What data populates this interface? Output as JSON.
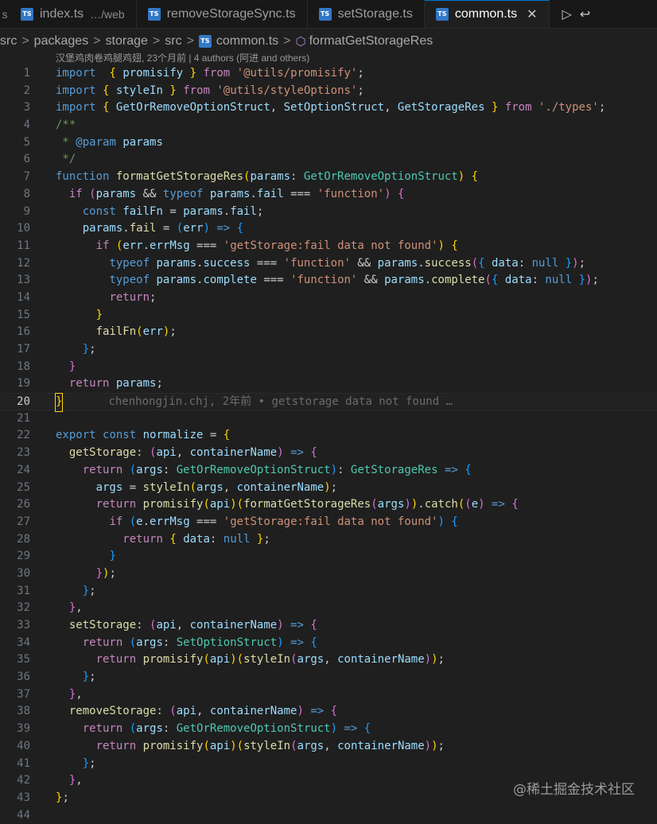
{
  "tabs": [
    {
      "label": "index.ts",
      "desc": "…/web",
      "active": false
    },
    {
      "label": "removeStorageSync.ts",
      "desc": "",
      "active": false
    },
    {
      "label": "setStorage.ts",
      "desc": "",
      "active": false
    },
    {
      "label": "common.ts",
      "desc": "",
      "active": true
    }
  ],
  "tab_icon_text": "TS",
  "tab_close_glyph": "✕",
  "tab_actions": [
    "▷",
    "↩"
  ],
  "breadcrumb": {
    "items": [
      "src",
      "packages",
      "storage",
      "src",
      "common.ts",
      "formatGetStorageRes"
    ],
    "separator": ">"
  },
  "blame_top": "汉堡鸡肉卷鸡腿鸡翅, 23个月前 | 4 authors (阿进 and others)",
  "inline_blame": "chenhongjin.chj, 2年前 • getstorage data not found …",
  "current_line": 20,
  "watermark": "@稀土掘金技术社区",
  "line_numbers": [
    "1",
    "2",
    "3",
    "4",
    "5",
    "6",
    "7",
    "8",
    "9",
    "10",
    "11",
    "12",
    "13",
    "14",
    "15",
    "16",
    "17",
    "18",
    "19",
    "20",
    "21",
    "22",
    "23",
    "24",
    "25",
    "26",
    "27",
    "28",
    "29",
    "30",
    "31",
    "32",
    "33",
    "34",
    "35",
    "36",
    "37",
    "38",
    "39",
    "40",
    "41",
    "42",
    "43",
    "44"
  ],
  "code": [
    [
      [
        "k",
        "import"
      ],
      [
        "",
        "  "
      ],
      [
        "b1",
        "{"
      ],
      [
        "",
        " "
      ],
      [
        "v",
        "promisify"
      ],
      [
        "",
        " "
      ],
      [
        "b1",
        "}"
      ],
      [
        "",
        " "
      ],
      [
        "c",
        "from"
      ],
      [
        "",
        " "
      ],
      [
        "s",
        "'@utils/promisify'"
      ],
      [
        "",
        ";"
      ]
    ],
    [
      [
        "k",
        "import"
      ],
      [
        "",
        " "
      ],
      [
        "b1",
        "{"
      ],
      [
        "",
        " "
      ],
      [
        "v",
        "styleIn"
      ],
      [
        "",
        " "
      ],
      [
        "b1",
        "}"
      ],
      [
        "",
        " "
      ],
      [
        "c",
        "from"
      ],
      [
        "",
        " "
      ],
      [
        "s",
        "'@utils/styleOptions'"
      ],
      [
        "",
        ";"
      ]
    ],
    [
      [
        "k",
        "import"
      ],
      [
        "",
        " "
      ],
      [
        "b1",
        "{"
      ],
      [
        "",
        " "
      ],
      [
        "v",
        "GetOrRemoveOptionStruct"
      ],
      [
        "",
        ", "
      ],
      [
        "v",
        "SetOptionStruct"
      ],
      [
        "",
        ", "
      ],
      [
        "v",
        "GetStorageRes"
      ],
      [
        "",
        " "
      ],
      [
        "b1",
        "}"
      ],
      [
        "",
        " "
      ],
      [
        "c",
        "from"
      ],
      [
        "",
        " "
      ],
      [
        "s",
        "'./types'"
      ],
      [
        "",
        ";"
      ]
    ],
    [
      [
        "cm",
        "/**"
      ]
    ],
    [
      [
        "cm",
        " * "
      ],
      [
        "cmt",
        "@param"
      ],
      [
        "",
        " "
      ],
      [
        "v",
        "params"
      ]
    ],
    [
      [
        "cm",
        " */"
      ]
    ],
    [
      [
        "k",
        "function"
      ],
      [
        "",
        " "
      ],
      [
        "f",
        "formatGetStorageRes"
      ],
      [
        "b1",
        "("
      ],
      [
        "v",
        "params"
      ],
      [
        "",
        ": "
      ],
      [
        "t",
        "GetOrRemoveOptionStruct"
      ],
      [
        "b1",
        ")"
      ],
      [
        "",
        " "
      ],
      [
        "b1",
        "{"
      ]
    ],
    [
      [
        "",
        "  "
      ],
      [
        "c",
        "if"
      ],
      [
        "",
        " "
      ],
      [
        "b2",
        "("
      ],
      [
        "v",
        "params"
      ],
      [
        "",
        " && "
      ],
      [
        "k",
        "typeof"
      ],
      [
        "",
        " "
      ],
      [
        "v",
        "params"
      ],
      [
        "",
        "."
      ],
      [
        "v",
        "fail"
      ],
      [
        "",
        " === "
      ],
      [
        "s",
        "'function'"
      ],
      [
        "b2",
        ")"
      ],
      [
        "",
        " "
      ],
      [
        "b2",
        "{"
      ]
    ],
    [
      [
        "",
        "    "
      ],
      [
        "k",
        "const"
      ],
      [
        "",
        " "
      ],
      [
        "v",
        "failFn"
      ],
      [
        "",
        " = "
      ],
      [
        "v",
        "params"
      ],
      [
        "",
        "."
      ],
      [
        "v",
        "fail"
      ],
      [
        "",
        ";"
      ]
    ],
    [
      [
        "",
        "    "
      ],
      [
        "v",
        "params"
      ],
      [
        "",
        "."
      ],
      [
        "f",
        "fail"
      ],
      [
        "",
        " = "
      ],
      [
        "b3",
        "("
      ],
      [
        "v",
        "err"
      ],
      [
        "b3",
        ")"
      ],
      [
        "",
        " "
      ],
      [
        "k",
        "=>"
      ],
      [
        "",
        " "
      ],
      [
        "b3",
        "{"
      ]
    ],
    [
      [
        "",
        "      "
      ],
      [
        "c",
        "if"
      ],
      [
        "",
        " "
      ],
      [
        "b1",
        "("
      ],
      [
        "v",
        "err"
      ],
      [
        "",
        "."
      ],
      [
        "v",
        "errMsg"
      ],
      [
        "",
        " === "
      ],
      [
        "s",
        "'getStorage:fail data not found'"
      ],
      [
        "b1",
        ")"
      ],
      [
        "",
        " "
      ],
      [
        "b1",
        "{"
      ]
    ],
    [
      [
        "",
        "        "
      ],
      [
        "k",
        "typeof"
      ],
      [
        "",
        " "
      ],
      [
        "v",
        "params"
      ],
      [
        "",
        "."
      ],
      [
        "v",
        "success"
      ],
      [
        "",
        " === "
      ],
      [
        "s",
        "'function'"
      ],
      [
        "",
        " && "
      ],
      [
        "v",
        "params"
      ],
      [
        "",
        "."
      ],
      [
        "f",
        "success"
      ],
      [
        "b2",
        "("
      ],
      [
        "b3",
        "{"
      ],
      [
        "",
        " "
      ],
      [
        "v",
        "data"
      ],
      [
        "",
        ": "
      ],
      [
        "k",
        "null"
      ],
      [
        "",
        " "
      ],
      [
        "b3",
        "}"
      ],
      [
        "b2",
        ")"
      ],
      [
        "",
        ";"
      ]
    ],
    [
      [
        "",
        "        "
      ],
      [
        "k",
        "typeof"
      ],
      [
        "",
        " "
      ],
      [
        "v",
        "params"
      ],
      [
        "",
        "."
      ],
      [
        "v",
        "complete"
      ],
      [
        "",
        " === "
      ],
      [
        "s",
        "'function'"
      ],
      [
        "",
        " && "
      ],
      [
        "v",
        "params"
      ],
      [
        "",
        "."
      ],
      [
        "f",
        "complete"
      ],
      [
        "b2",
        "("
      ],
      [
        "b3",
        "{"
      ],
      [
        "",
        " "
      ],
      [
        "v",
        "data"
      ],
      [
        "",
        ": "
      ],
      [
        "k",
        "null"
      ],
      [
        "",
        " "
      ],
      [
        "b3",
        "}"
      ],
      [
        "b2",
        ")"
      ],
      [
        "",
        ";"
      ]
    ],
    [
      [
        "",
        "        "
      ],
      [
        "c",
        "return"
      ],
      [
        "",
        ";"
      ]
    ],
    [
      [
        "",
        "      "
      ],
      [
        "b1",
        "}"
      ]
    ],
    [
      [
        "",
        "      "
      ],
      [
        "f",
        "failFn"
      ],
      [
        "b1",
        "("
      ],
      [
        "v",
        "err"
      ],
      [
        "b1",
        ")"
      ],
      [
        "",
        ";"
      ]
    ],
    [
      [
        "",
        "    "
      ],
      [
        "b3",
        "}"
      ],
      [
        "",
        ";"
      ]
    ],
    [
      [
        "",
        "  "
      ],
      [
        "b2",
        "}"
      ]
    ],
    [
      [
        "",
        "  "
      ],
      [
        "c",
        "return"
      ],
      [
        "",
        " "
      ],
      [
        "v",
        "params"
      ],
      [
        "",
        ";"
      ]
    ],
    [
      [
        "b1",
        "}"
      ]
    ],
    [],
    [
      [
        "k",
        "export"
      ],
      [
        "",
        " "
      ],
      [
        "k",
        "const"
      ],
      [
        "",
        " "
      ],
      [
        "v",
        "normalize"
      ],
      [
        "",
        " = "
      ],
      [
        "b1",
        "{"
      ]
    ],
    [
      [
        "",
        "  "
      ],
      [
        "f",
        "getStorage"
      ],
      [
        "",
        ": "
      ],
      [
        "b2",
        "("
      ],
      [
        "v",
        "api"
      ],
      [
        "",
        ", "
      ],
      [
        "v",
        "containerName"
      ],
      [
        "b2",
        ")"
      ],
      [
        "",
        " "
      ],
      [
        "k",
        "=>"
      ],
      [
        "",
        " "
      ],
      [
        "b2",
        "{"
      ]
    ],
    [
      [
        "",
        "    "
      ],
      [
        "c",
        "return"
      ],
      [
        "",
        " "
      ],
      [
        "b3",
        "("
      ],
      [
        "v",
        "args"
      ],
      [
        "",
        ": "
      ],
      [
        "t",
        "GetOrRemoveOptionStruct"
      ],
      [
        "b3",
        ")"
      ],
      [
        "",
        ": "
      ],
      [
        "t",
        "GetStorageRes"
      ],
      [
        "",
        " "
      ],
      [
        "k",
        "=>"
      ],
      [
        "",
        " "
      ],
      [
        "b3",
        "{"
      ]
    ],
    [
      [
        "",
        "      "
      ],
      [
        "v",
        "args"
      ],
      [
        "",
        " = "
      ],
      [
        "f",
        "styleIn"
      ],
      [
        "b1",
        "("
      ],
      [
        "v",
        "args"
      ],
      [
        "",
        ", "
      ],
      [
        "v",
        "containerName"
      ],
      [
        "b1",
        ")"
      ],
      [
        "",
        ";"
      ]
    ],
    [
      [
        "",
        "      "
      ],
      [
        "c",
        "return"
      ],
      [
        "",
        " "
      ],
      [
        "f",
        "promisify"
      ],
      [
        "b1",
        "("
      ],
      [
        "v",
        "api"
      ],
      [
        "b1",
        ")"
      ],
      [
        "b1",
        "("
      ],
      [
        "f",
        "formatGetStorageRes"
      ],
      [
        "b2",
        "("
      ],
      [
        "v",
        "args"
      ],
      [
        "b2",
        ")"
      ],
      [
        "b1",
        ")"
      ],
      [
        "",
        "."
      ],
      [
        "f",
        "catch"
      ],
      [
        "b1",
        "("
      ],
      [
        "b2",
        "("
      ],
      [
        "v",
        "e"
      ],
      [
        "b2",
        ")"
      ],
      [
        "",
        " "
      ],
      [
        "k",
        "=>"
      ],
      [
        "",
        " "
      ],
      [
        "b2",
        "{"
      ]
    ],
    [
      [
        "",
        "        "
      ],
      [
        "c",
        "if"
      ],
      [
        "",
        " "
      ],
      [
        "b3",
        "("
      ],
      [
        "v",
        "e"
      ],
      [
        "",
        "."
      ],
      [
        "v",
        "errMsg"
      ],
      [
        "",
        " === "
      ],
      [
        "s",
        "'getStorage:fail data not found'"
      ],
      [
        "b3",
        ")"
      ],
      [
        "",
        " "
      ],
      [
        "b3",
        "{"
      ]
    ],
    [
      [
        "",
        "          "
      ],
      [
        "c",
        "return"
      ],
      [
        "",
        " "
      ],
      [
        "b1",
        "{"
      ],
      [
        "",
        " "
      ],
      [
        "v",
        "data"
      ],
      [
        "",
        ": "
      ],
      [
        "k",
        "null"
      ],
      [
        "",
        " "
      ],
      [
        "b1",
        "}"
      ],
      [
        "",
        ";"
      ]
    ],
    [
      [
        "",
        "        "
      ],
      [
        "b3",
        "}"
      ]
    ],
    [
      [
        "",
        "      "
      ],
      [
        "b2",
        "}"
      ],
      [
        "b1",
        ")"
      ],
      [
        "",
        ";"
      ]
    ],
    [
      [
        "",
        "    "
      ],
      [
        "b3",
        "}"
      ],
      [
        "",
        ";"
      ]
    ],
    [
      [
        "",
        "  "
      ],
      [
        "b2",
        "}"
      ],
      [
        "",
        ","
      ]
    ],
    [
      [
        "",
        "  "
      ],
      [
        "f",
        "setStorage"
      ],
      [
        "",
        ": "
      ],
      [
        "b2",
        "("
      ],
      [
        "v",
        "api"
      ],
      [
        "",
        ", "
      ],
      [
        "v",
        "containerName"
      ],
      [
        "b2",
        ")"
      ],
      [
        "",
        " "
      ],
      [
        "k",
        "=>"
      ],
      [
        "",
        " "
      ],
      [
        "b2",
        "{"
      ]
    ],
    [
      [
        "",
        "    "
      ],
      [
        "c",
        "return"
      ],
      [
        "",
        " "
      ],
      [
        "b3",
        "("
      ],
      [
        "v",
        "args"
      ],
      [
        "",
        ": "
      ],
      [
        "t",
        "SetOptionStruct"
      ],
      [
        "b3",
        ")"
      ],
      [
        "",
        " "
      ],
      [
        "k",
        "=>"
      ],
      [
        "",
        " "
      ],
      [
        "b3",
        "{"
      ]
    ],
    [
      [
        "",
        "      "
      ],
      [
        "c",
        "return"
      ],
      [
        "",
        " "
      ],
      [
        "f",
        "promisify"
      ],
      [
        "b1",
        "("
      ],
      [
        "v",
        "api"
      ],
      [
        "b1",
        ")"
      ],
      [
        "b1",
        "("
      ],
      [
        "f",
        "styleIn"
      ],
      [
        "b2",
        "("
      ],
      [
        "v",
        "args"
      ],
      [
        "",
        ", "
      ],
      [
        "v",
        "containerName"
      ],
      [
        "b2",
        ")"
      ],
      [
        "b1",
        ")"
      ],
      [
        "",
        ";"
      ]
    ],
    [
      [
        "",
        "    "
      ],
      [
        "b3",
        "}"
      ],
      [
        "",
        ";"
      ]
    ],
    [
      [
        "",
        "  "
      ],
      [
        "b2",
        "}"
      ],
      [
        "",
        ","
      ]
    ],
    [
      [
        "",
        "  "
      ],
      [
        "f",
        "removeStorage"
      ],
      [
        "",
        ": "
      ],
      [
        "b2",
        "("
      ],
      [
        "v",
        "api"
      ],
      [
        "",
        ", "
      ],
      [
        "v",
        "containerName"
      ],
      [
        "b2",
        ")"
      ],
      [
        "",
        " "
      ],
      [
        "k",
        "=>"
      ],
      [
        "",
        " "
      ],
      [
        "b2",
        "{"
      ]
    ],
    [
      [
        "",
        "    "
      ],
      [
        "c",
        "return"
      ],
      [
        "",
        " "
      ],
      [
        "b3",
        "("
      ],
      [
        "v",
        "args"
      ],
      [
        "",
        ": "
      ],
      [
        "t",
        "GetOrRemoveOptionStruct"
      ],
      [
        "b3",
        ")"
      ],
      [
        "",
        " "
      ],
      [
        "k",
        "=>"
      ],
      [
        "",
        " "
      ],
      [
        "b3",
        "{"
      ]
    ],
    [
      [
        "",
        "      "
      ],
      [
        "c",
        "return"
      ],
      [
        "",
        " "
      ],
      [
        "f",
        "promisify"
      ],
      [
        "b1",
        "("
      ],
      [
        "v",
        "api"
      ],
      [
        "b1",
        ")"
      ],
      [
        "b1",
        "("
      ],
      [
        "f",
        "styleIn"
      ],
      [
        "b2",
        "("
      ],
      [
        "v",
        "args"
      ],
      [
        "",
        ", "
      ],
      [
        "v",
        "containerName"
      ],
      [
        "b2",
        ")"
      ],
      [
        "b1",
        ")"
      ],
      [
        "",
        ";"
      ]
    ],
    [
      [
        "",
        "    "
      ],
      [
        "b3",
        "}"
      ],
      [
        "",
        ";"
      ]
    ],
    [
      [
        "",
        "  "
      ],
      [
        "b2",
        "}"
      ],
      [
        "",
        ","
      ]
    ],
    [
      [
        "b1",
        "}"
      ],
      [
        "",
        ";"
      ]
    ],
    []
  ]
}
